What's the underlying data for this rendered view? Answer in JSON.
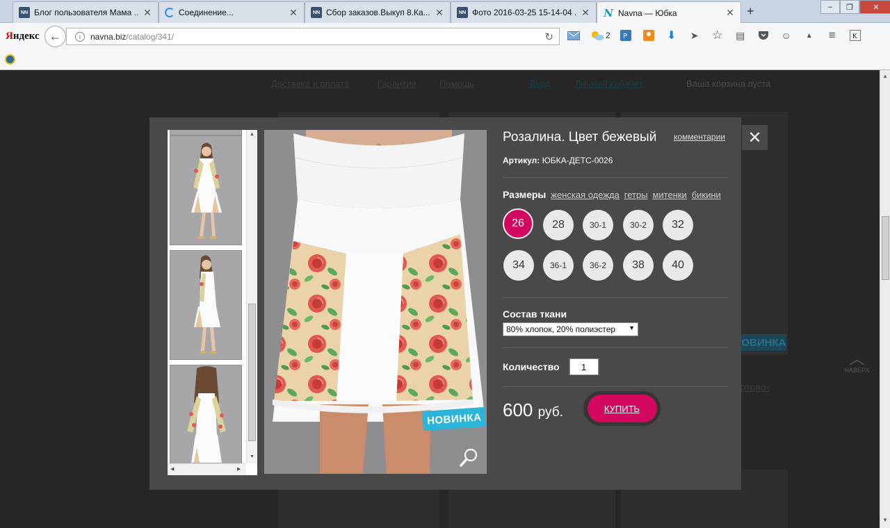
{
  "browser": {
    "tabs": [
      {
        "icon": "NN",
        "title": "Блог пользователя Мама ...",
        "active": false
      },
      {
        "icon": "loading",
        "title": "Соединение...",
        "active": false
      },
      {
        "icon": "NN",
        "title": "Сбор заказов.Выкуп 8.Ка...",
        "active": false
      },
      {
        "icon": "NN",
        "title": "Фото 2016-03-25 15-14-04 ...",
        "active": false
      },
      {
        "icon": "N",
        "title": "Navna — Юбка",
        "active": true
      }
    ],
    "newtab_label": "+",
    "yandex_logo_first": "Я",
    "yandex_logo_rest": "ндекс",
    "url_host": "navna.biz",
    "url_path": "/catalog/341/",
    "weather_badge": "2"
  },
  "page": {
    "nav": [
      "Доставка и оплата",
      "Гарантии",
      "Помощь"
    ],
    "user_links": [
      "Вход",
      "Личный кабинет"
    ],
    "cart": "Ваша корзина пуста",
    "ghost_badge": "НОВИНКА",
    "ghost_link": "ртово-",
    "up_label": "НАВЕРХ"
  },
  "modal": {
    "title": "Розалина. Цвет бежевый",
    "comments_label": "комментарии",
    "article_label": "Артикул:",
    "article_value": "ЮБКА-ДЕТС-0026",
    "sizes_label": "Размеры",
    "size_links": [
      "женская одежда",
      "гетры",
      "митенки",
      "бикини"
    ],
    "sizes": [
      "26",
      "28",
      "30-1",
      "30-2",
      "32",
      "34",
      "36-1",
      "36-2",
      "38",
      "40"
    ],
    "selected_size": "26",
    "fabric_label": "Состав ткани",
    "fabric_value": "80% хлопок, 20% полиэстер",
    "qty_label": "Количество",
    "qty_value": "1",
    "price_value": "600",
    "price_unit": "руб.",
    "buy_label": "КУПИТЬ",
    "badge_new": "НОВИНКА"
  },
  "colors": {
    "accent": "#d3095f",
    "badge": "#2bb5d8",
    "modal_bg": "#494949"
  }
}
